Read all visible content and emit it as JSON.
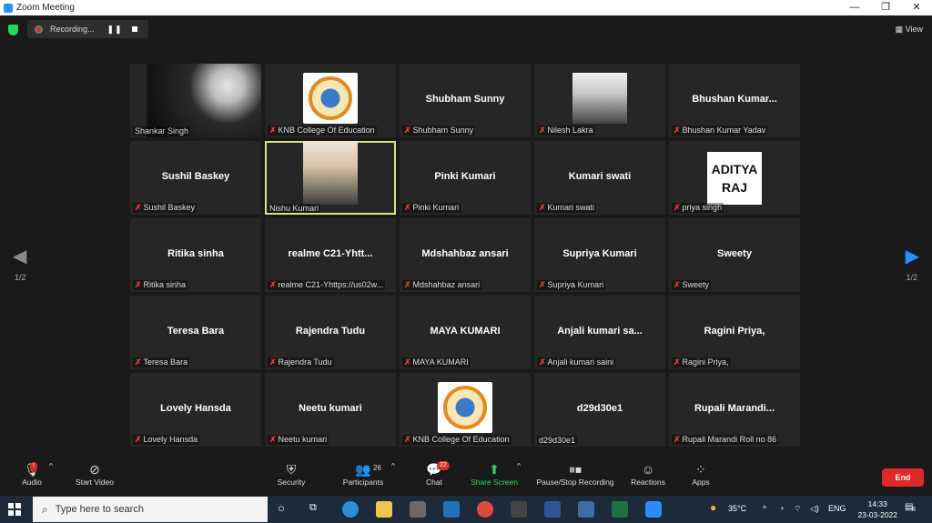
{
  "window": {
    "title": "Zoom Meeting"
  },
  "topbar": {
    "recording_label": "Recording...",
    "pause_glyph": "❚❚",
    "view_label": "View"
  },
  "tiles": [
    {
      "label": "Shankar Singh",
      "muted": false,
      "visual": "dark-video"
    },
    {
      "label": "KNB College Of Education",
      "muted": true,
      "visual": "college-logo"
    },
    {
      "label": "Shubham Sunny",
      "center": "Shubham Sunny",
      "muted": true
    },
    {
      "label": "Nilesh Lakra",
      "muted": true,
      "visual": "profile-photo"
    },
    {
      "label": "Bhushan Kumar Yadav",
      "center": "Bhushan  Kumar...",
      "muted": true
    },
    {
      "label": "Sushil Baskey",
      "center": "Sushil Baskey",
      "muted": true
    },
    {
      "label": "Nishu Kumari",
      "muted": false,
      "visual": "live-video",
      "active": true
    },
    {
      "label": "Pinki Kumari",
      "center": "Pinki Kumari",
      "muted": true
    },
    {
      "label": "Kumari swati",
      "center": "Kumari swati",
      "muted": true
    },
    {
      "label": "priya singh",
      "muted": true,
      "visual": "text-card",
      "card_lines": [
        "ADITYA",
        "RAJ"
      ]
    },
    {
      "label": "Ritika sinha",
      "center": "Ritika sinha",
      "muted": true
    },
    {
      "label": "realme C21-Yhttps://us02w...",
      "center": "realme  C21-Yhtt...",
      "muted": true
    },
    {
      "label": "Mdshahbaz ansari",
      "center": "Mdshahbaz ansari",
      "muted": true
    },
    {
      "label": "Supriya Kumari",
      "center": "Supriya Kumari",
      "muted": true
    },
    {
      "label": "Sweety",
      "center": "Sweety",
      "muted": true
    },
    {
      "label": "Teresa Bara",
      "center": "Teresa Bara",
      "muted": true
    },
    {
      "label": "Rajendra Tudu",
      "center": "Rajendra Tudu",
      "muted": true
    },
    {
      "label": "MAYA KUMARI",
      "center": "MAYA KUMARI",
      "muted": true
    },
    {
      "label": "Anjali kumari saini",
      "center": "Anjali  kumari  sa...",
      "muted": true
    },
    {
      "label": "Ragini Priya,",
      "center": "Ragini Priya,",
      "muted": true
    },
    {
      "label": "Lovely Hansda",
      "center": "Lovely Hansda",
      "muted": true
    },
    {
      "label": "Neetu kumari",
      "center": "Neetu kumari",
      "muted": true
    },
    {
      "label": "KNB College Of Education",
      "muted": true,
      "visual": "college-logo"
    },
    {
      "label": "d29d30e1",
      "center": "d29d30e1",
      "muted": false
    },
    {
      "label": "Rupali Marandi Roll no 86",
      "center": "Rupali  Marandi...",
      "muted": true
    }
  ],
  "pagination": {
    "left": "1/2",
    "right": "1/2"
  },
  "toolbar": {
    "audio": "Audio",
    "audio_badge": "!",
    "start_video": "Start Video",
    "security": "Security",
    "participants": "Participants",
    "participants_count": "26",
    "chat": "Chat",
    "chat_badge": "22",
    "share_screen": "Share Screen",
    "pause_stop_recording": "Pause/Stop Recording",
    "reactions": "Reactions",
    "apps": "Apps",
    "end": "End"
  },
  "taskbar": {
    "search_placeholder": "Type here to search",
    "weather": "35°C",
    "language": "ENG",
    "time": "14:33",
    "date": "23-03-2022",
    "notification_count": "8"
  },
  "colors": {
    "accent": "#2d8cff",
    "muted_red": "#e53a3a",
    "share_green": "#23d959",
    "end_red": "#e02828",
    "active_outline": "#d8e27a"
  }
}
